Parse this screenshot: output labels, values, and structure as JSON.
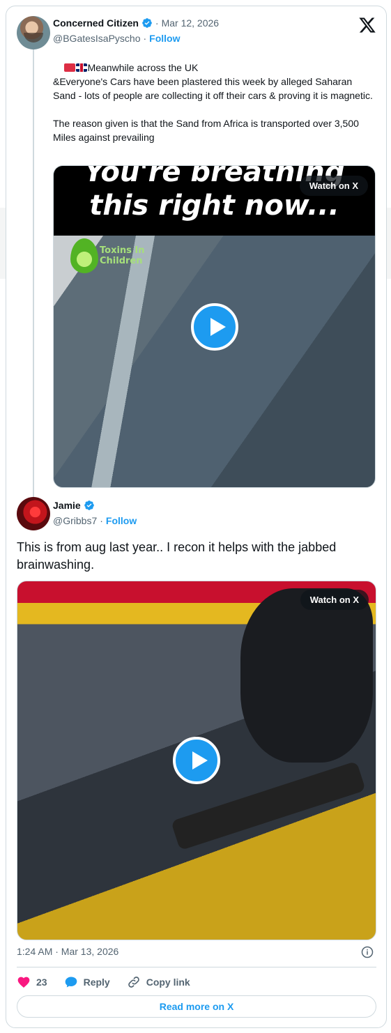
{
  "colors": {
    "accent": "#1d9bf0",
    "muted": "#536471",
    "like": "#f91880",
    "border": "#cfd9de"
  },
  "main_tweet": {
    "author_name": "Concerned Citizen",
    "separator": "·",
    "date": "Mar 12, 2026",
    "handle": "@BGatesIsaPyscho",
    "follow": "Follow",
    "text_line1": "Meanwhile across the UK",
    "text_body": "&Everyone's Cars have been plastered this week by alleged Saharan Sand - lots of people are collecting it off their cars & proving it is magnetic.\n\nThe reason given is that the Sand from Africa is transported over 3,500 Miles against prevailing",
    "video": {
      "overlay_line1": "You're breathing",
      "overlay_line2": "this right now...",
      "logo_text_1": "Toxins In",
      "logo_text_2": "Children",
      "watch_label": "Watch on X"
    }
  },
  "reply_tweet": {
    "author_name": "Jamie",
    "handle": "@Gribbs7",
    "separator": "·",
    "follow": "Follow",
    "text": "This is from aug last year.. I recon it helps with the jabbed brainwashing.",
    "video": {
      "watch_label": "Watch on X"
    }
  },
  "footer": {
    "timestamp": "1:24 AM · Mar 13, 2026",
    "likes": "23",
    "reply": "Reply",
    "copy_link": "Copy link",
    "read_more": "Read more on X"
  }
}
